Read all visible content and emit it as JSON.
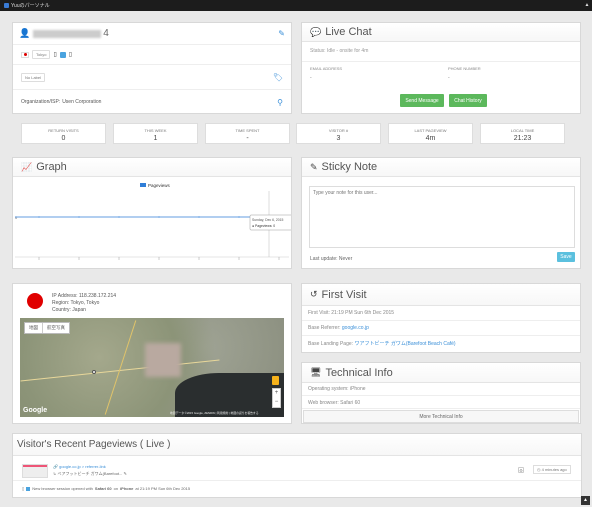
{
  "browser": {
    "tab_title": "Yuuのパーソナル"
  },
  "visitor": {
    "name_mask": "4",
    "city_tag": "Tokyo",
    "label_tag": "No Label",
    "org_label": "Organization/ISP:",
    "org_value": "Usen Corporation"
  },
  "live_chat": {
    "title": "Live Chat",
    "status": "Status: Idle - onsite for 4m",
    "email_label": "EMAIL ADDRESS",
    "email_value": "-",
    "phone_label": "PHONE NUMBER",
    "phone_value": "-",
    "send_button": "Send Message",
    "history_button": "Chat History"
  },
  "stats": [
    {
      "label": "RETURN VISITS",
      "value": "0"
    },
    {
      "label": "THIS WEEK",
      "value": "1"
    },
    {
      "label": "TIME SPENT",
      "value": "-"
    },
    {
      "label": "VISITOR #",
      "value": "3"
    },
    {
      "label": "LAST PAGEVIEW",
      "value": "4m"
    },
    {
      "label": "LOCAL TIME",
      "value": "21:23"
    }
  ],
  "graph": {
    "title": "Graph",
    "legend": "Pageviews",
    "tooltip_date": "Sunday, Dec 6, 2015",
    "tooltip_value": "● Pageviews: 0",
    "y_zero": "0",
    "colors": {
      "series": "#2f7ed8"
    }
  },
  "chart_data": {
    "type": "line",
    "title": "",
    "series": [
      {
        "name": "Pageviews",
        "values": [
          0,
          0,
          0,
          0,
          0,
          0,
          0
        ]
      }
    ],
    "categories": [
      "",
      "",
      "",
      "",
      "",
      "",
      ""
    ],
    "ylabel": "",
    "xlabel": ""
  },
  "sticky": {
    "title": "Sticky Note",
    "placeholder": "Type your note for this user...",
    "last_update": "Last update: Never",
    "save_button": "Save"
  },
  "location": {
    "ip": "IP Address: 118.238.172.214",
    "region": "Region: Tokyo, Tokyo",
    "country": "Country: Japan",
    "map_btn": "地図",
    "sat_btn": "航空写真",
    "google": "Google",
    "credits": "地図データ ©2015 Google, ZENRIN | 利用規約 | 地図の誤りを報告する",
    "zoom_in": "+",
    "zoom_out": "−"
  },
  "first_visit": {
    "title": "First Visit",
    "visit_line": "First Visit: 21:19 PM Sun 6th Dec 2015",
    "referrer_label": "Base Referrer:",
    "referrer_link": "google.co.jp",
    "landing_label": "Base Landing Page:",
    "landing_link": "ワアフトビーチ ガワム(Barefoot Beach Café)"
  },
  "tech": {
    "title": "Technical Info",
    "os": "Operating system: iPhone",
    "browser": "Web browser: Safari 60",
    "more_button": "More Technical Info"
  },
  "pageviews": {
    "title": "Visitor's Recent Pageviews ( Live )",
    "ref": "google.co.jp > referrer-link",
    "page": "ベアフットビーチ ガワム(Barefoot...",
    "time": "4 minutes ago",
    "session_prefix": "New browser session opened with ",
    "session_browser": "Safari 60",
    "session_mid": " on ",
    "session_device": "iPhone",
    "session_suffix": " at 21:19 PM Sun 6th Dec 2015"
  }
}
